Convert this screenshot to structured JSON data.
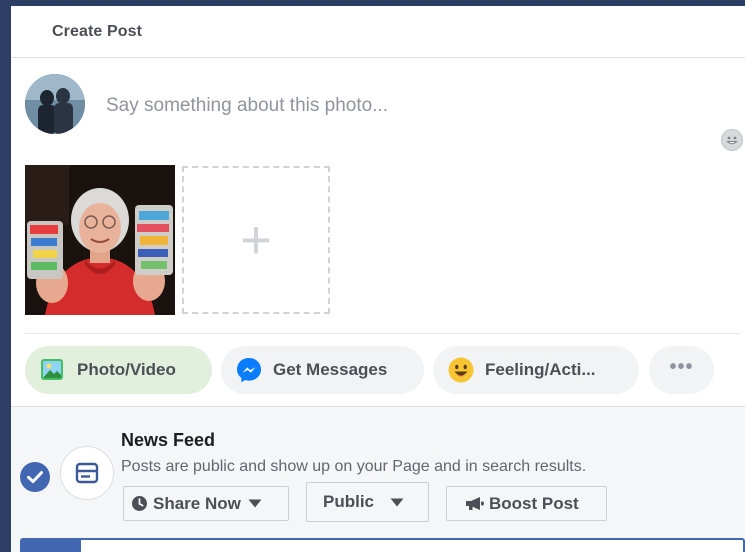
{
  "header": {
    "tab_label": "Create Post"
  },
  "composer": {
    "placeholder": "Say something about this photo...",
    "value": ""
  },
  "media": {
    "add_label": "+"
  },
  "actions": [
    {
      "label": "Photo/Video",
      "icon": "photo-icon",
      "active": true
    },
    {
      "label": "Get Messages",
      "icon": "messenger-icon",
      "active": false
    },
    {
      "label": "Feeling/Acti...",
      "icon": "feeling-icon",
      "active": false
    },
    {
      "label": "•••",
      "icon": "more-icon",
      "active": false
    }
  ],
  "news_feed": {
    "title": "News Feed",
    "description": "Posts are public and show up on your Page and in search results.",
    "checked": true
  },
  "controls": {
    "share_now": "Share Now",
    "audience": "Public",
    "boost": "Boost Post"
  },
  "colors": {
    "accent": "#4267b2",
    "active_pill": "#e1efdc",
    "page_background": "#2c3e63"
  }
}
